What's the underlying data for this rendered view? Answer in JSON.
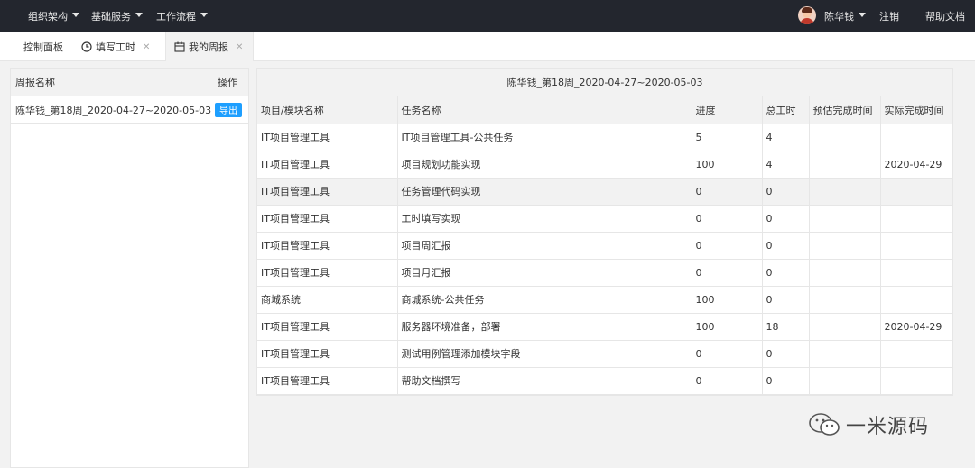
{
  "topnav": {
    "menus": [
      "组织架构",
      "基础服务",
      "工作流程"
    ],
    "user_name": "陈华钱",
    "logout": "注销",
    "help": "帮助文档"
  },
  "tabs": [
    {
      "label": "控制面板"
    },
    {
      "label": "填写工时"
    },
    {
      "label": "我的周报"
    }
  ],
  "left_panel": {
    "col_name": "周报名称",
    "col_action": "操作",
    "rows": [
      {
        "name": "陈华钱_第18周_2020-04-27~2020-05-03",
        "action": "导出"
      }
    ]
  },
  "report": {
    "title": "陈华钱_第18周_2020-04-27~2020-05-03",
    "columns": [
      "项目/模块名称",
      "任务名称",
      "进度",
      "总工时",
      "预估完成时间",
      "实际完成时间"
    ],
    "rows": [
      [
        "IT项目管理工具",
        "IT项目管理工具-公共任务",
        "5",
        "4",
        "",
        ""
      ],
      [
        "IT项目管理工具",
        "项目规划功能实现",
        "100",
        "4",
        "",
        "2020-04-29"
      ],
      [
        "IT项目管理工具",
        "任务管理代码实现",
        "0",
        "0",
        "",
        ""
      ],
      [
        "IT项目管理工具",
        "工时填写实现",
        "0",
        "0",
        "",
        ""
      ],
      [
        "IT项目管理工具",
        "项目周汇报",
        "0",
        "0",
        "",
        ""
      ],
      [
        "IT项目管理工具",
        "项目月汇报",
        "0",
        "0",
        "",
        ""
      ],
      [
        "商城系统",
        "商城系统-公共任务",
        "100",
        "0",
        "",
        ""
      ],
      [
        "IT项目管理工具",
        "服务器环境准备，部署",
        "100",
        "18",
        "",
        "2020-04-29"
      ],
      [
        "IT项目管理工具",
        "测试用例管理添加模块字段",
        "0",
        "0",
        "",
        ""
      ],
      [
        "IT项目管理工具",
        "帮助文档撰写",
        "0",
        "0",
        "",
        ""
      ]
    ]
  },
  "watermark": "一米源码"
}
